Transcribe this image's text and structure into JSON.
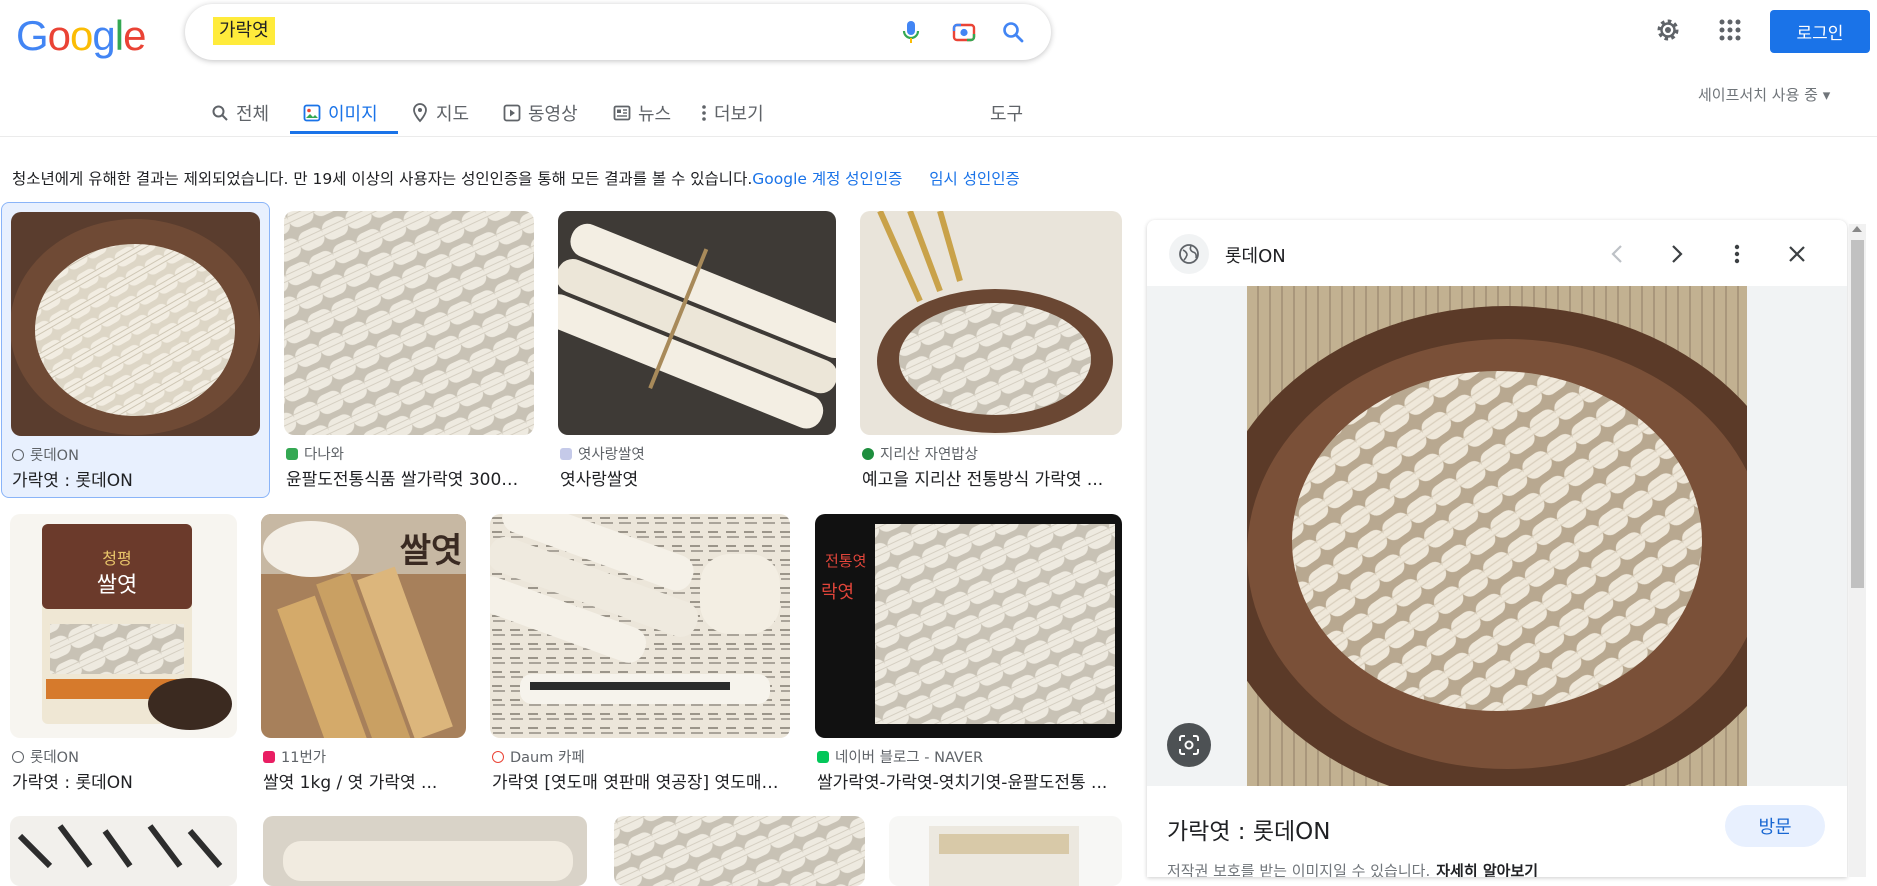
{
  "logo": {
    "letters": [
      "G",
      "o",
      "o",
      "g",
      "l",
      "e"
    ],
    "colors": [
      "#4285f4",
      "#ea4335",
      "#fbbc05",
      "#4285f4",
      "#34a853",
      "#ea4335"
    ]
  },
  "search": {
    "query": "가락엿",
    "mic_icon": "mic-icon",
    "camera_icon": "camera-icon",
    "search_icon": "search-icon"
  },
  "header": {
    "settings_icon": "gear-icon",
    "apps_icon": "grid-icon",
    "login_label": "로그인"
  },
  "tabs": [
    {
      "label": "전체",
      "icon": "search-icon"
    },
    {
      "label": "이미지",
      "icon": "image-icon",
      "active": true
    },
    {
      "label": "지도",
      "icon": "pin-icon"
    },
    {
      "label": "동영상",
      "icon": "play-icon"
    },
    {
      "label": "뉴스",
      "icon": "news-icon"
    },
    {
      "label": "더보기",
      "icon": "more-icon"
    }
  ],
  "tools_label": "도구",
  "safesearch_label": "세이프서치 사용 중 ▾",
  "notice": {
    "text": "청소년에게 유해한 결과는 제외되었습니다. 만 19세 이상의 사용자는 성인인증을 통해 모든 결과를 볼 수 있습니다.",
    "link1": "Google 계정 성인인증",
    "link2": "임시 성인인증"
  },
  "results": [
    {
      "source": "롯데ON",
      "title": "가락엿 : 롯데ON",
      "fav": "#5f6368"
    },
    {
      "source": "다나와",
      "title": "윤팔도전통식품 쌀가락엿 300g ...",
      "fav": "#34a853"
    },
    {
      "source": "엿사랑쌀엿",
      "title": "엿사랑쌀엿",
      "fav": "#9aa0a6"
    },
    {
      "source": "지리산 자연밥상",
      "title": "예고을 지리산 전통방식 가락엿 ...",
      "fav": "#1e8e3e"
    },
    {
      "source": "롯데ON",
      "title": "가락엿 : 롯데ON",
      "fav": "#5f6368"
    },
    {
      "source": "11번가",
      "title": "쌀엿 1kg / 엿 가락엿 ...",
      "fav": "#e91e63"
    },
    {
      "source": "Daum 카페",
      "title": "가락엿 [엿도매 엿판매 엿공장] 엿도매 ...",
      "fav": "#ea4335"
    },
    {
      "source": "네이버 블로그 - NAVER",
      "title": "쌀가락엿-가락엿-엿치기엿-윤팔도전통 ...",
      "fav": "#03c75a"
    }
  ],
  "thumb_overlay": {
    "ssal_yeot": "쌀엿",
    "cheongpyeong_1": "청평",
    "cheongpyeong_2": "쌀엿",
    "jeontong": "전통엿",
    "rak": "락엿"
  },
  "panel": {
    "source": "롯데ON",
    "title": "가락엿 : 롯데ON",
    "visit_label": "방문",
    "copyright": "저작권 보호를 받는 이미지일 수 있습니다.",
    "learn_more": "자세히 알아보기"
  }
}
